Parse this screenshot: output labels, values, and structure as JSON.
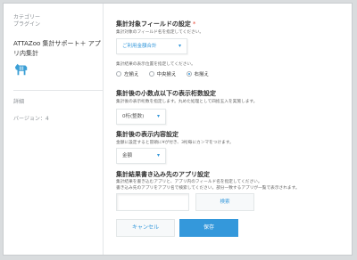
{
  "sidebar": {
    "category": "カテゴリー",
    "plugin_label": "プラグイン",
    "app_name": "ATTAZoo 集計サポート＋ アプリ内集計",
    "detail": "詳細",
    "version": "バージョン：4"
  },
  "sections": {
    "target_field": {
      "title": "集計対象フィールドの設定",
      "required_mark": "*",
      "description": "集計対象のフィールド名を指定してください。",
      "selected": "ご利用金額合計"
    },
    "position": {
      "description": "集計結果の表示位置を指定してください。",
      "options": [
        "左揃え",
        "中央揃え",
        "右揃え"
      ],
      "selected_index": 2
    },
    "decimal": {
      "title": "集計後の小数点以下の表示桁数設定",
      "description": "集計後の表示桁数を指定します。丸めた処理として四捨五入を実施します。",
      "selected": "0桁(整数)"
    },
    "display": {
      "title": "集計後の表示内容設定",
      "description": "金額に設定すると冒頭に¥が付き、3桁毎にカンマをつけます。",
      "selected": "金額"
    },
    "target_app": {
      "title": "集計結果書き込み先のアプリ設定",
      "description_1": "集計結果を書き込むアプリと、アプリ内のフィールド名を指定してください。",
      "description_2": "書き込み先のアプリをアプリ名で検索してください。部分一致するアプリが一覧で表示されます。",
      "input_value": "",
      "search_label": "検索"
    }
  },
  "buttons": {
    "cancel": "キャンセル",
    "save": "保存"
  },
  "colors": {
    "accent": "#3498db",
    "required": "#e74c3c"
  }
}
